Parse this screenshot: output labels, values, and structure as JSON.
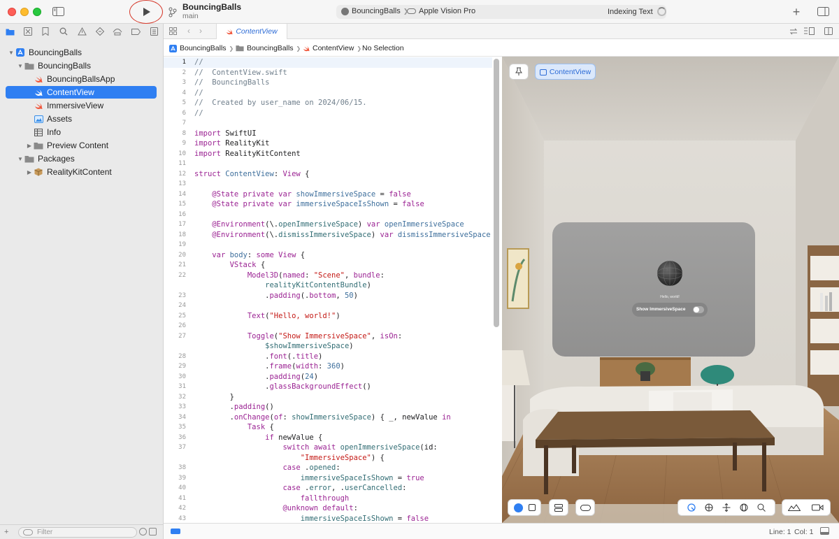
{
  "toolbar": {
    "project_name": "BouncingBalls",
    "branch": "main",
    "activity": {
      "scheme": "BouncingBalls",
      "destination": "Apple Vision Pro",
      "status": "Indexing Text"
    }
  },
  "navigator": {
    "items": [
      {
        "label": "BouncingBalls",
        "icon": "app-project-icon"
      },
      {
        "label": "BouncingBalls",
        "icon": "folder-icon"
      },
      {
        "label": "BouncingBallsApp",
        "icon": "swift-file-icon"
      },
      {
        "label": "ContentView",
        "icon": "swift-file-icon",
        "selected": true
      },
      {
        "label": "ImmersiveView",
        "icon": "swift-file-icon"
      },
      {
        "label": "Assets",
        "icon": "asset-catalog-icon"
      },
      {
        "label": "Info",
        "icon": "plist-table-icon"
      },
      {
        "label": "Preview Content",
        "icon": "folder-icon"
      },
      {
        "label": "Packages",
        "icon": "folder-icon"
      },
      {
        "label": "RealityKitContent",
        "icon": "package-icon"
      }
    ],
    "filter_placeholder": "Filter"
  },
  "editor": {
    "tab_label": "ContentView",
    "breadcrumb": [
      "BouncingBalls",
      "BouncingBalls",
      "ContentView",
      "No Selection"
    ],
    "line_numbers": [
      "1",
      "2",
      "3",
      "4",
      "5",
      "6",
      "7",
      "8",
      "9",
      "10",
      "11",
      "12",
      "13",
      "14",
      "15",
      "16",
      "17",
      "18",
      "19",
      "20",
      "21",
      "22",
      "",
      "23",
      "24",
      "25",
      "26",
      "27",
      "",
      "28",
      "29",
      "30",
      "31",
      "32",
      "33",
      "34",
      "35",
      "36",
      "37",
      "",
      "38",
      "39",
      "40",
      "41",
      "42",
      "43"
    ]
  },
  "preview": {
    "pin_tooltip": "",
    "selector_label": "ContentView",
    "window_text": "Hello, world!",
    "toggle_label": "Show ImmersiveSpace"
  },
  "status": {
    "line": "Line: 1",
    "col": "Col: 1"
  },
  "colors": {
    "accent": "#2f7ff2",
    "keyword": "#9b2393",
    "string": "#c41a16",
    "comment": "#707f8c",
    "type": "#3e6f9c"
  }
}
